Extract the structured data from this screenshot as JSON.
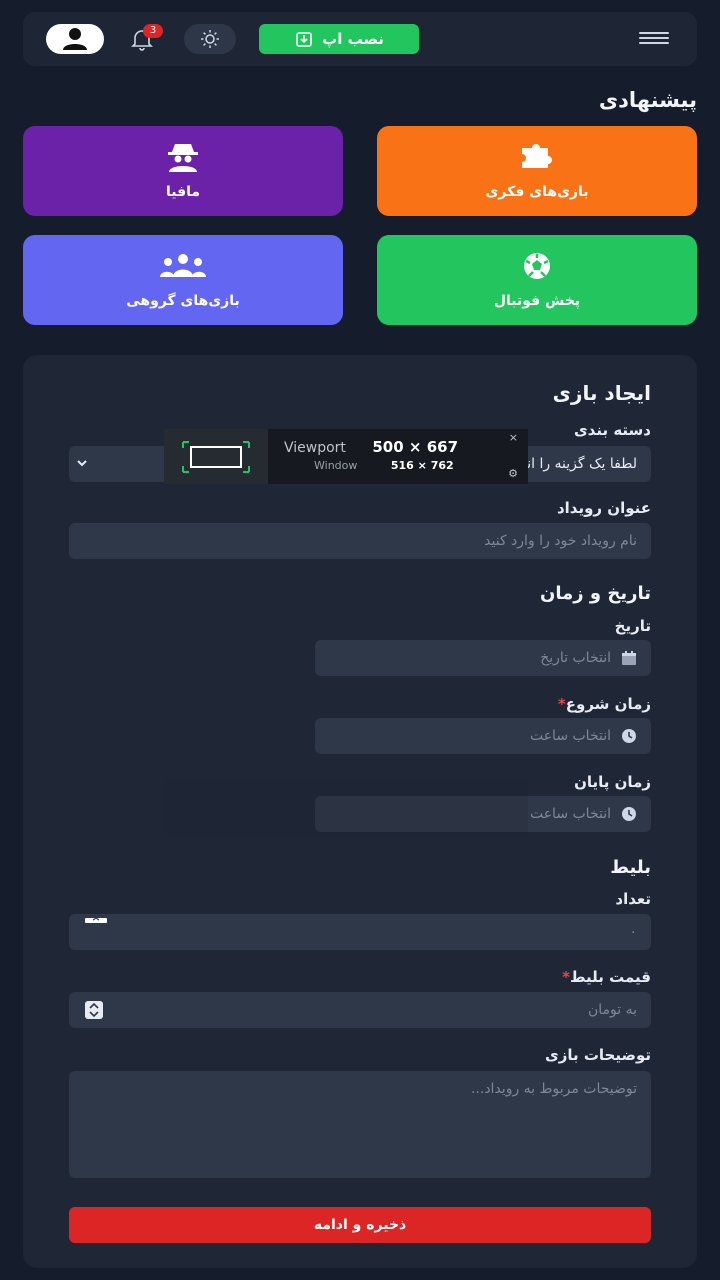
{
  "topbar": {
    "install_label": "نصب اپ",
    "notification_count": "3"
  },
  "suggested": {
    "title": "پیشنهادی",
    "tiles": [
      {
        "label": "بازی‌های فکری",
        "color": "#f97316",
        "icon": "puzzle-icon"
      },
      {
        "label": "مافیا",
        "color": "#6b21a8",
        "icon": "spy-icon"
      },
      {
        "label": "پخش فوتبال",
        "color": "#22c55e",
        "icon": "football-icon"
      },
      {
        "label": "بازی‌های گروهی",
        "color": "#6366f1",
        "icon": "group-icon"
      }
    ]
  },
  "form": {
    "title": "ایجاد بازی",
    "category_label": "دسته بندی",
    "category_value": "لطفا یک گزینه را انتخاب کنید",
    "event_title_label": "عنوان رویداد",
    "event_title_placeholder": "نام رویداد خود را وارد کنید",
    "datetime_title": "تاریخ و زمان",
    "date_label": "تاریخ",
    "date_placeholder": "انتخاب تاریخ",
    "start_label": "زمان شروع",
    "start_placeholder": "انتخاب ساعت",
    "end_label": "زمان پایان",
    "end_placeholder": "انتخاب ساعت",
    "ticket_title": "بلیط",
    "count_label": "تعداد",
    "count_value": "۰",
    "price_label": "قیمت بلیط",
    "price_placeholder": "به تومان",
    "desc_label": "توضیحات بازی",
    "desc_placeholder": "توضیحات مربوط به رویداد...",
    "save_label": "ذخیره و ادامه",
    "required_mark": "*"
  },
  "viewport_overlay": {
    "viewport_label": "Viewport",
    "viewport_size": "500 × 667",
    "window_label": "Window",
    "window_size": "516 × 762",
    "close": "×",
    "gear": "⚙"
  }
}
